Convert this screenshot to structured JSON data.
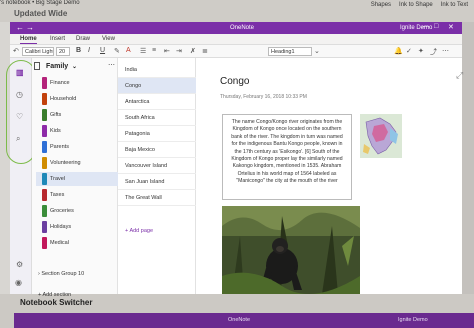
{
  "background": {
    "top_title": "'s notebook • Big Stage Demo",
    "top_subtitle": "Updated Wide",
    "top_tools": [
      "Shapes",
      "Ink to Shape",
      "Ink to Text"
    ],
    "bottom_label": "Notebook Switcher",
    "bottom_title": "OneNote",
    "bottom_user": "Ignite Demo"
  },
  "window": {
    "title": "OneNote",
    "user": "Ignite Demo",
    "back_icon": "back-arrow-icon",
    "forward_icon": "forward-arrow-icon",
    "min_glyph": "—",
    "max_glyph": "□",
    "close_glyph": "✕"
  },
  "ribbon": {
    "tabs": [
      "Home",
      "Insert",
      "Draw",
      "View"
    ],
    "active_tab": "Home",
    "font_name": "Calibri Light",
    "font_size": "20",
    "style": "Heading1",
    "bold": "B",
    "italic": "I",
    "underline": "U"
  },
  "rail": {
    "items": [
      "notebooks-icon",
      "recent-icon",
      "favorites-icon",
      "search-icon"
    ],
    "bottom_items": [
      "settings-icon",
      "profile-icon"
    ]
  },
  "notebook": {
    "name": "Family",
    "sections": [
      {
        "label": "Finance",
        "color": "#b4237a"
      },
      {
        "label": "Household",
        "color": "#c2410c"
      },
      {
        "label": "Gifts",
        "color": "#3a7d2c"
      },
      {
        "label": "Kids",
        "color": "#8e2aa8"
      },
      {
        "label": "Parents",
        "color": "#2f6fd6"
      },
      {
        "label": "Volunteering",
        "color": "#d08c00"
      },
      {
        "label": "Travel",
        "color": "#1e88b8"
      },
      {
        "label": "Taxes",
        "color": "#b7282e"
      },
      {
        "label": "Groceries",
        "color": "#3b8d3a"
      },
      {
        "label": "Holidays",
        "color": "#6b3fa0"
      },
      {
        "label": "Medical",
        "color": "#c2185b"
      }
    ],
    "active_section": "Travel",
    "section_group": "Section Group 10",
    "add_section": "Add section"
  },
  "pages": {
    "items": [
      "India",
      "Congo",
      "Antarctica",
      "South Africa",
      "Patagonia",
      "Baja Mexico",
      "Vancouver Island",
      "San Juan Island",
      "The Great Wall"
    ],
    "active": "Congo",
    "add_page": "Add page"
  },
  "canvas": {
    "title": "Congo",
    "date": "Thursday, February 16, 2018  10:33 PM",
    "note": "The name Congo/Kongo river originates from the Kingdom of Kongo once located on the southern bank of the river. The kingdom in turn was named for the indigenous Bantu Kongo people, known in the 17th century as 'Esikongo'. [6] South of the Kingdom of Kongo proper lay the similarly named Kakongo kingdom, mentioned in 1535. Abraham Ortelius in his world map of 1564 labeled as \"Manicongo\" the city at the mouth of the river"
  }
}
